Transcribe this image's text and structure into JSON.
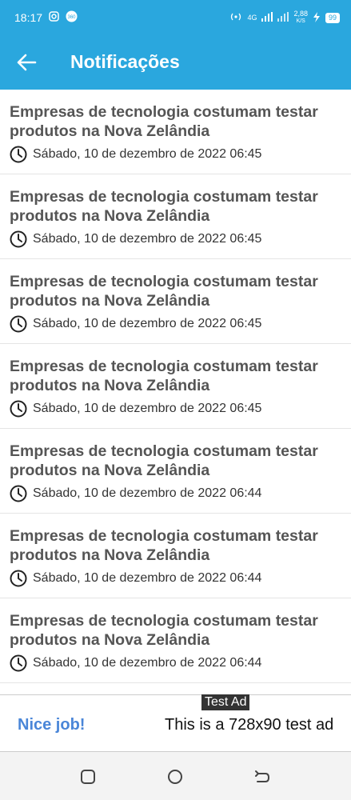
{
  "status_bar": {
    "time": "18:17",
    "network": "4G",
    "speed_value": "2,88",
    "speed_unit": "K/S",
    "battery": "99"
  },
  "app_bar": {
    "title": "Notificações",
    "back_icon": "arrow-back-icon",
    "color": "#2aa7de"
  },
  "notifications": [
    {
      "title": "Empresas de tecnologia costumam testar produtos na Nova Zelândia",
      "date": "Sábado, 10 de dezembro de 2022 06:45"
    },
    {
      "title": "Empresas de tecnologia costumam testar produtos na Nova Zelândia",
      "date": "Sábado, 10 de dezembro de 2022 06:45"
    },
    {
      "title": "Empresas de tecnologia costumam testar produtos na Nova Zelândia",
      "date": "Sábado, 10 de dezembro de 2022 06:45"
    },
    {
      "title": "Empresas de tecnologia costumam testar produtos na Nova Zelândia",
      "date": "Sábado, 10 de dezembro de 2022 06:45"
    },
    {
      "title": "Empresas de tecnologia costumam testar produtos na Nova Zelândia",
      "date": "Sábado, 10 de dezembro de 2022 06:44"
    },
    {
      "title": "Empresas de tecnologia costumam testar produtos na Nova Zelândia",
      "date": "Sábado, 10 de dezembro de 2022 06:44"
    },
    {
      "title": "Empresas de tecnologia costumam testar produtos na Nova Zelândia",
      "date": "Sábado, 10 de dezembro de 2022 06:44"
    }
  ],
  "ad": {
    "label": "Test Ad",
    "nice": "Nice job!",
    "text": "This is a 728x90 test ad"
  },
  "nav": {
    "recents_icon": "square-icon",
    "home_icon": "circle-icon",
    "back_icon": "back-arrow-icon"
  }
}
